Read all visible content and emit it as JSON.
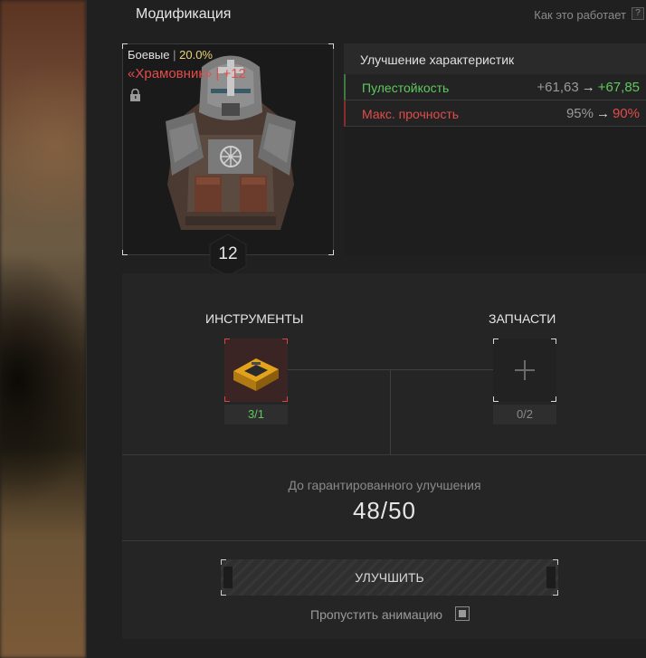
{
  "header": {
    "title": "Модификация",
    "help_link": "Как это работает",
    "help_icon": "?"
  },
  "item": {
    "category": "Боевые",
    "separator": "|",
    "percent": "20.0%",
    "name": "«Храмовник» | +12",
    "level": "12",
    "lock_icon": "lock-icon"
  },
  "stats": {
    "title": "Улучшение характеристик",
    "rows": [
      {
        "name": "Пулестойкость",
        "old": "+61,63",
        "arrow": "→",
        "new": "+67,85",
        "status": "good"
      },
      {
        "name": "Макс. прочность",
        "old": "95%",
        "arrow": "→",
        "new": "90%",
        "status": "bad"
      }
    ]
  },
  "requirements": {
    "tools": {
      "title": "ИНСТРУМЕНТЫ",
      "count": "3/1",
      "icon": "toolbox-icon",
      "status_color": "#5fc85f"
    },
    "parts": {
      "title": "ЗАПЧАСТИ",
      "count": "0/2",
      "icon": "plus-icon",
      "status_color": "#8a8a8a"
    }
  },
  "guarantee": {
    "label": "До гарантированного улучшения",
    "value": "48/50",
    "progress": 0.96
  },
  "actions": {
    "upgrade_label": "УЛУЧШИТЬ",
    "skip_animation_label": "Пропустить анимацию",
    "skip_animation_checked": true
  },
  "colors": {
    "positive": "#5fc85f",
    "negative": "#e24c4c",
    "highlight": "#e8d27a"
  }
}
